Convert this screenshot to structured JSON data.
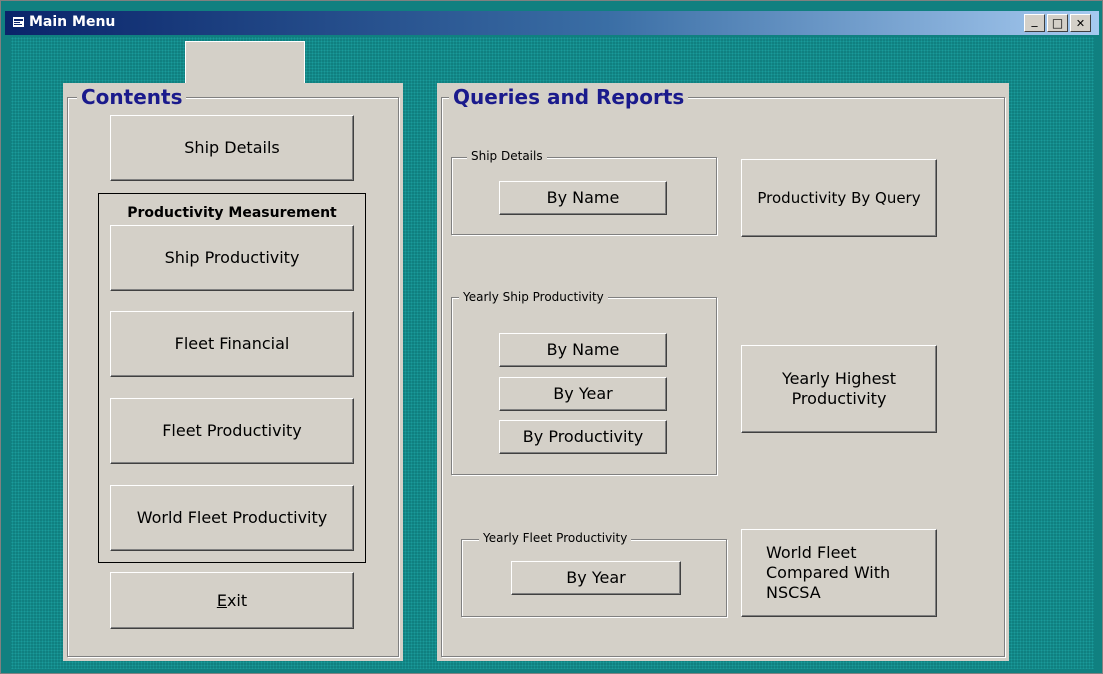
{
  "window": {
    "title": "Main Menu",
    "caption_buttons": {
      "minimize": "_",
      "maximize": "□",
      "close": "✕"
    }
  },
  "contents": {
    "legend": "Contents",
    "ship_details": "Ship Details",
    "productivity_group": {
      "label": "Productivity Measurement",
      "items": [
        "Ship Productivity",
        "Fleet Financial",
        "Fleet Productivity",
        "World Fleet Productivity"
      ]
    },
    "exit_pre": "",
    "exit_mnemonic": "E",
    "exit_post": "xit"
  },
  "queries": {
    "legend": "Queries and Reports",
    "ship_details_group": {
      "label": "Ship Details",
      "by_name": "By Name"
    },
    "productivity_by_query": "Productivity By Query",
    "yearly_ship_group": {
      "label": "Yearly Ship Productivity",
      "by_name": "By Name",
      "by_year": "By Year",
      "by_productivity": "By Productivity"
    },
    "yearly_highest": "Yearly Highest Productivity",
    "yearly_fleet_group": {
      "label": "Yearly Fleet Productivity",
      "by_year": "By Year"
    },
    "world_fleet_compared": "World Fleet Compared With NSCSA"
  }
}
